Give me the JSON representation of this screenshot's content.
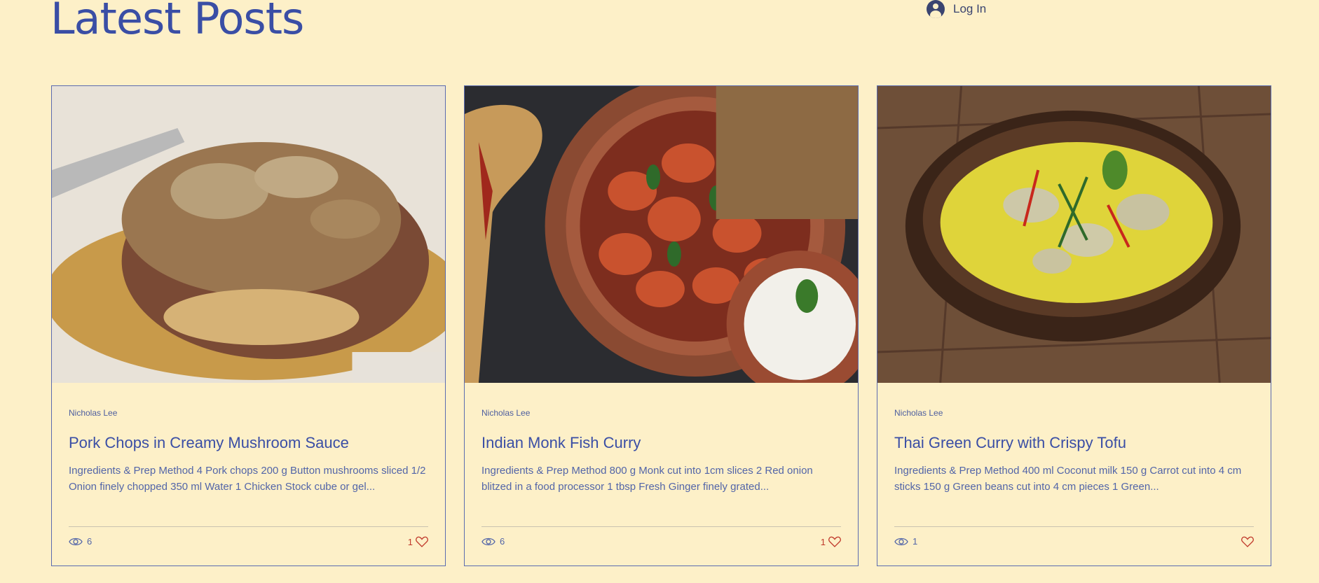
{
  "header": {
    "page_title": "Latest Posts",
    "login_label": "Log In",
    "login_icon": "user-avatar-icon"
  },
  "colors": {
    "background": "#fdf0c8",
    "accent": "#3a4ea5",
    "like": "#c0392b"
  },
  "posts": [
    {
      "image": "pork-chop-mushroom-sauce-photo",
      "author": "Nicholas Lee",
      "title": "Pork Chops in Creamy Mushroom Sauce",
      "excerpt": "Ingredients & Prep Method 4 Pork chops  200 g  Button mushrooms sliced 1/2 Onion finely chopped 350 ml  Water 1 Chicken Stock cube or gel...",
      "views": "6",
      "likes": "1",
      "view_icon": "eye-icon",
      "like_icon": "heart-icon"
    },
    {
      "image": "monk-fish-curry-photo",
      "author": "Nicholas Lee",
      "title": "Indian Monk Fish Curry",
      "excerpt": "Ingredients & Prep Method 800 g  Monk cut into 1cm slices 2 Red onion blitzed in a food processor 1 tbsp  Fresh Ginger finely grated...",
      "views": "6",
      "likes": "1",
      "view_icon": "eye-icon",
      "like_icon": "heart-icon"
    },
    {
      "image": "thai-green-curry-photo",
      "author": "Nicholas Lee",
      "title": "Thai Green Curry with Crispy Tofu",
      "excerpt": "Ingredients & Prep Method 400 ml  Coconut milk 150 g  Carrot cut into 4 cm sticks 150 g  Green beans cut into 4 cm pieces 1 Green...",
      "views": "1",
      "likes": "",
      "view_icon": "eye-icon",
      "like_icon": "heart-icon"
    }
  ]
}
